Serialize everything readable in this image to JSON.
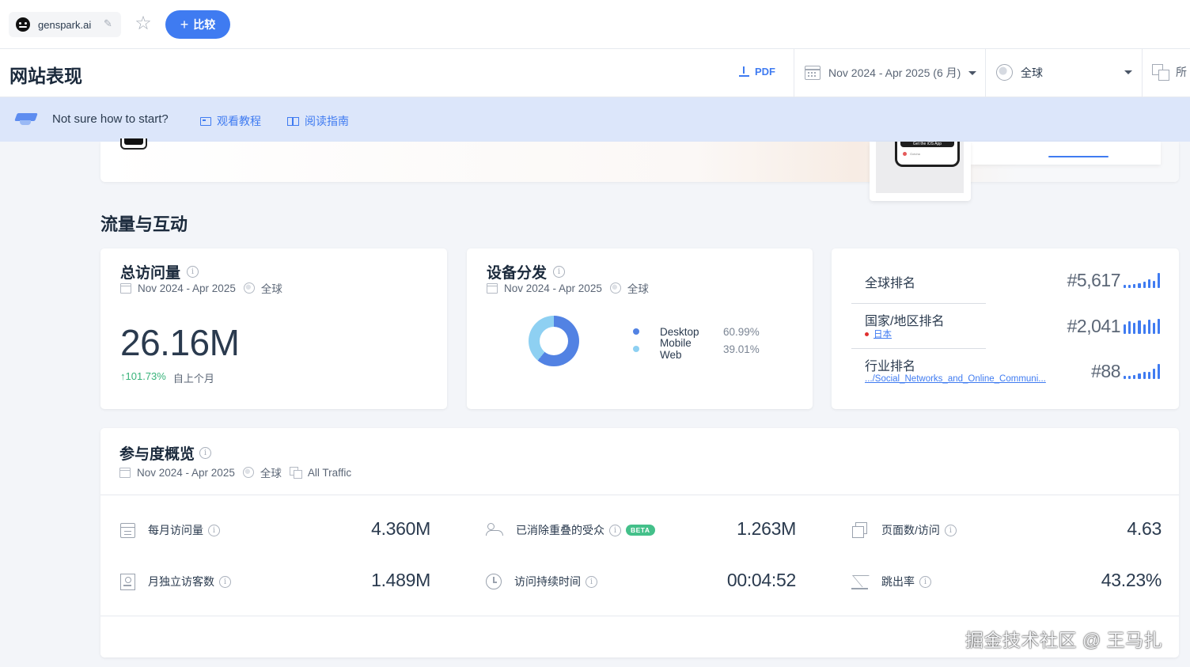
{
  "topbar": {
    "site_name": "genspark.ai",
    "compare_label": "比较"
  },
  "header": {
    "title": "网站表现",
    "pdf_label": "PDF",
    "date_range": "Nov 2024 - Apr 2025 (6 月)",
    "region": "全球",
    "traffic_type_partial": "所"
  },
  "help_banner": {
    "text": "Not sure how to start?",
    "tutorial_label": "观看教程",
    "guide_label": "阅读指南"
  },
  "hero": {
    "phone_bar_text": "Get the iOS App",
    "phone_text": "Gotcha"
  },
  "section_title": "流量与互动",
  "total_visits": {
    "title": "总访问量",
    "date_range": "Nov 2024 - Apr 2025",
    "region": "全球",
    "value": "26.16M",
    "change": "101.73%",
    "change_label": "自上个月"
  },
  "device_distribution": {
    "title": "设备分发",
    "date_range": "Nov 2024 - Apr 2025",
    "region": "全球",
    "segments": [
      {
        "name": "Desktop",
        "value": "60.99%",
        "share": 60.99,
        "color": "#5282e3"
      },
      {
        "name": "Mobile Web",
        "value": "39.01%",
        "share": 39.01,
        "color": "#8ed0f2"
      }
    ]
  },
  "rankings": [
    {
      "label": "全球排名",
      "value": "#5,617",
      "sub": ""
    },
    {
      "label": "国家/地区排名",
      "value": "#2,041",
      "sub": "日本"
    },
    {
      "label": "行业排名",
      "value": "#88",
      "sub": ".../Social_Networks_and_Online_Communi..."
    }
  ],
  "engagement": {
    "title": "参与度概览",
    "date_range": "Nov 2024 - Apr 2025",
    "region": "全球",
    "traffic": "All Traffic",
    "beta_label": "BETA",
    "metrics": [
      {
        "label": "每月访问量",
        "value": "4.360M",
        "icon": "calendar-icon"
      },
      {
        "label": "已消除重叠的受众",
        "value": "1.263M",
        "icon": "people-icon"
      },
      {
        "label": "页面数/访问",
        "value": "4.63",
        "icon": "pages-icon"
      },
      {
        "label": "月独立访客数",
        "value": "1.489M",
        "icon": "visitor-badge-icon"
      },
      {
        "label": "访问持续时间",
        "value": "00:04:52",
        "icon": "timer-icon"
      },
      {
        "label": "跳出率",
        "value": "43.23%",
        "icon": "bounce-icon"
      }
    ]
  },
  "watermark": "掘金技术社区 @ 王马扎"
}
